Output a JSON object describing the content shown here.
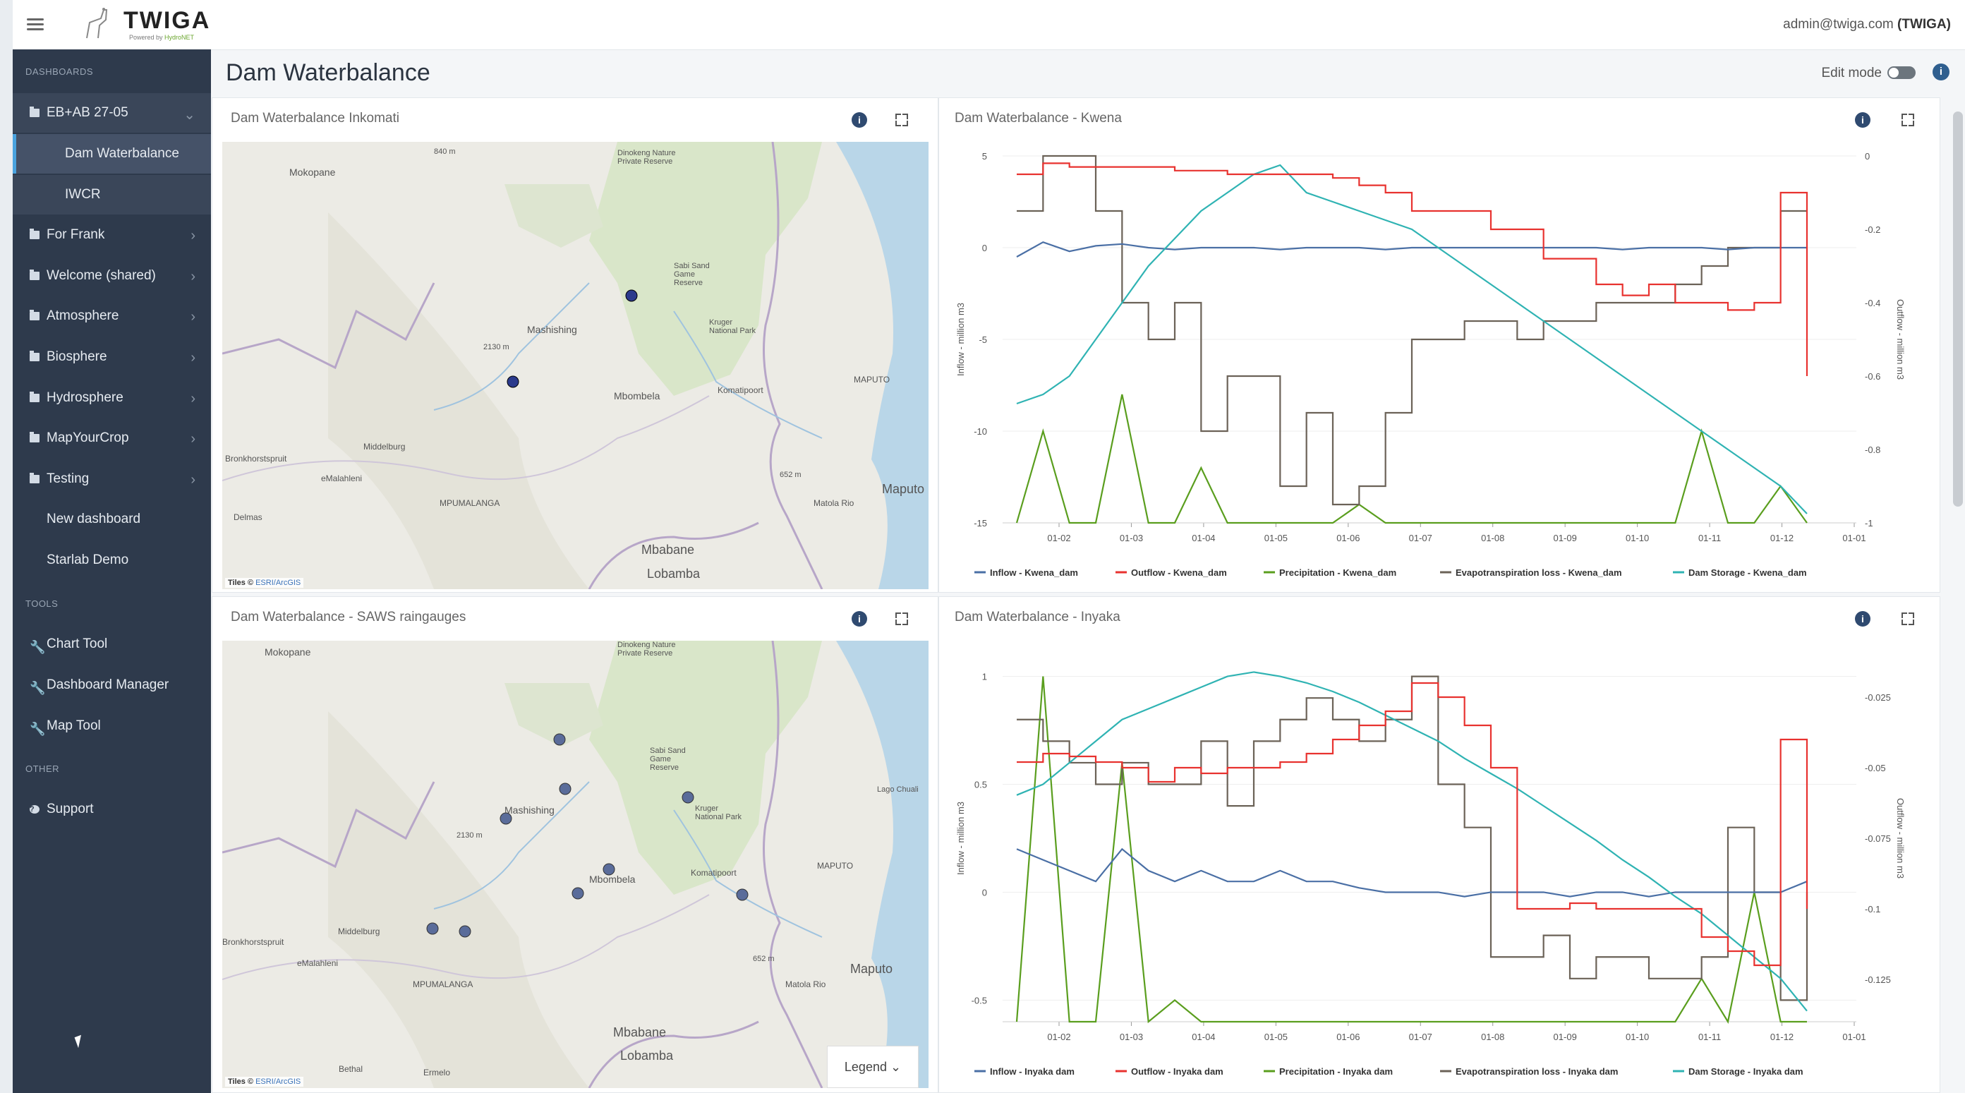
{
  "app": {
    "logo_text": "TWIGA",
    "logo_sub_prefix": "Powered by",
    "logo_sub_brand": "HydroNET",
    "user_name": "admin@twiga.com",
    "user_org": "(TWIGA)"
  },
  "sidebar": {
    "section_dashboards": "DASHBOARDS",
    "section_tools": "TOOLS",
    "section_other": "OTHER",
    "items": [
      {
        "label": "EB+AB 27-05"
      },
      {
        "label": "Dam Waterbalance"
      },
      {
        "label": "IWCR"
      },
      {
        "label": "For Frank"
      },
      {
        "label": "Welcome (shared)"
      },
      {
        "label": "Atmosphere"
      },
      {
        "label": "Biosphere"
      },
      {
        "label": "Hydrosphere"
      },
      {
        "label": "MapYourCrop"
      },
      {
        "label": "Testing"
      },
      {
        "label": "New dashboard"
      },
      {
        "label": "Starlab Demo"
      }
    ],
    "tools": [
      {
        "label": "Chart Tool"
      },
      {
        "label": "Dashboard Manager"
      },
      {
        "label": "Map Tool"
      }
    ],
    "other": [
      {
        "label": "Support"
      }
    ]
  },
  "page": {
    "title": "Dam Waterbalance",
    "edit_mode_label": "Edit mode",
    "edit_mode_on": false
  },
  "panels": {
    "map1": {
      "title": "Dam Waterbalance Inkomati",
      "labels": [
        "Mokopane",
        "Dinokeng Nature Private Reserve",
        "Sabi Sand Game Reserve",
        "Mashishing",
        "Kruger National Park",
        "2130 m",
        "Mbombela",
        "Komatipoort",
        "MAPUTO",
        "Middelburg",
        "Bronkhorstspruit",
        "eMalahleni",
        "MPUMALANGA",
        "Matola Rio",
        "Maputo",
        "652 m",
        "Delmas",
        "Mbabane",
        "Lobamba",
        "840 m"
      ],
      "attribution_prefix": "Tiles ©",
      "attribution_link": "ESRI/ArcGIS"
    },
    "map2": {
      "title": "Dam Waterbalance - SAWS raingauges",
      "labels": [
        "Mokopane",
        "Dinokeng Nature Private Reserve",
        "Sabi Sand Game Reserve",
        "Mashishing",
        "Kruger National Park",
        "2130 m",
        "Mbombela",
        "Komatipoort",
        "MAPUTO",
        "Middelburg",
        "Bronkhorstspruit",
        "eMalahleni",
        "MPUMALANGA",
        "Matola Rio",
        "Maputo",
        "652 m",
        "Mbabane",
        "Lobamba",
        "Bethal",
        "Ermelo",
        "Lago Chuali"
      ],
      "attribution_prefix": "Tiles ©",
      "attribution_link": "ESRI/ArcGIS",
      "legend_label": "Legend"
    },
    "chart1": {
      "title": "Dam Waterbalance - Kwena"
    },
    "chart2": {
      "title": "Dam Waterbalance - Inyaka"
    }
  },
  "colors": {
    "inflow": "#4a6fa5",
    "outflow": "#e8322f",
    "precip": "#5a9e1e",
    "evap": "#6b6257",
    "storage": "#2fb3b3",
    "dots": "#2b3a8c"
  },
  "chart_data": [
    {
      "type": "line",
      "title": "Dam Waterbalance - Kwena",
      "x_ticks": [
        "01-02",
        "01-03",
        "01-04",
        "01-05",
        "01-06",
        "01-07",
        "01-08",
        "01-09",
        "01-10",
        "01-11",
        "01-12",
        "01-01"
      ],
      "ylabel": "Inflow - million m3",
      "y2label": "Outflow - million m3",
      "y_ticks": [
        "5",
        "0",
        "-5",
        "-10",
        "-15"
      ],
      "y2_ticks": [
        "0",
        "-0.2",
        "-0.4",
        "-0.6",
        "-0.8",
        "-1"
      ],
      "ylim": [
        -15,
        5
      ],
      "y2lim": [
        -1,
        0
      ],
      "series": [
        {
          "name": "Inflow - Kwena_dam",
          "key": "inflow",
          "axis": "left",
          "values": [
            -0.5,
            0.3,
            -0.2,
            0.1,
            0.2,
            0,
            -0.1,
            0,
            0,
            0,
            -0.1,
            0,
            0,
            0,
            -0.1,
            0,
            0,
            0,
            0,
            0,
            0,
            0,
            0,
            -0.1,
            0,
            0,
            0,
            -0.1,
            0,
            0,
            0
          ]
        },
        {
          "name": "Outflow - Kwena_dam",
          "key": "outflow",
          "axis": "right",
          "values": [
            -0.05,
            -0.02,
            -0.03,
            -0.03,
            -0.03,
            -0.03,
            -0.04,
            -0.04,
            -0.05,
            -0.05,
            -0.05,
            -0.05,
            -0.06,
            -0.08,
            -0.1,
            -0.15,
            -0.15,
            -0.15,
            -0.2,
            -0.2,
            -0.28,
            -0.28,
            -0.35,
            -0.38,
            -0.35,
            -0.4,
            -0.4,
            -0.42,
            -0.4,
            -0.1,
            -0.6
          ]
        },
        {
          "name": "Precipitation - Kwena_dam",
          "key": "precip",
          "axis": "left",
          "values": [
            -15,
            -10,
            -15,
            -15,
            -8,
            -15,
            -15,
            -12,
            -15,
            -15,
            -15,
            -15,
            -15,
            -14,
            -15,
            -15,
            -15,
            -15,
            -15,
            -15,
            -15,
            -15,
            -15,
            -15,
            -15,
            -15,
            -10,
            -15,
            -15,
            -13,
            -15
          ]
        },
        {
          "name": "Evapotranspiration loss - Kwena_dam",
          "key": "evap",
          "axis": "left",
          "values": [
            2,
            5,
            5,
            2,
            -3,
            -5,
            -3,
            -10,
            -7,
            -7,
            -13,
            -9,
            -14,
            -13,
            -9,
            -5,
            -5,
            -4,
            -4,
            -5,
            -4,
            -4,
            -3,
            -3,
            -3,
            -2,
            -1,
            0,
            0,
            2,
            2
          ]
        },
        {
          "name": "Dam Storage - Kwena_dam",
          "key": "storage",
          "axis": "left",
          "values": [
            -8.5,
            -8,
            -7,
            -5,
            -3,
            -1,
            0.5,
            2,
            3,
            4,
            4.5,
            3,
            2.5,
            2,
            1.5,
            1,
            0,
            -1,
            -2,
            -3,
            -4,
            -5,
            -6,
            -7,
            -8,
            -9,
            -10,
            -11,
            -12,
            -13,
            -14.5
          ]
        }
      ]
    },
    {
      "type": "line",
      "title": "Dam Waterbalance - Inyaka",
      "x_ticks": [
        "01-02",
        "01-03",
        "01-04",
        "01-05",
        "01-06",
        "01-07",
        "01-08",
        "01-09",
        "01-10",
        "01-11",
        "01-12",
        "01-01"
      ],
      "ylabel": "Inflow - million m3",
      "y2label": "Outflow - million m3",
      "y_ticks": [
        "1",
        "0.5",
        "0",
        "-0.5"
      ],
      "y2_ticks": [
        "-0.025",
        "-0.05",
        "-0.075",
        "-0.1",
        "-0.125"
      ],
      "ylim": [
        -0.6,
        1.1
      ],
      "y2lim": [
        -0.14,
        -0.01
      ],
      "series": [
        {
          "name": "Inflow - Inyaka dam",
          "key": "inflow",
          "axis": "left",
          "values": [
            0.2,
            0.15,
            0.1,
            0.05,
            0.2,
            0.1,
            0.05,
            0.1,
            0.05,
            0.05,
            0.1,
            0.05,
            0.05,
            0.02,
            0,
            0,
            0,
            -0.02,
            0,
            0,
            0,
            -0.02,
            0,
            0,
            -0.02,
            0,
            0,
            0,
            0,
            0,
            0.05
          ]
        },
        {
          "name": "Outflow - Inyaka dam",
          "key": "outflow",
          "axis": "right",
          "values": [
            -0.048,
            -0.045,
            -0.046,
            -0.048,
            -0.05,
            -0.055,
            -0.05,
            -0.052,
            -0.05,
            -0.05,
            -0.048,
            -0.045,
            -0.04,
            -0.035,
            -0.03,
            -0.02,
            -0.025,
            -0.035,
            -0.05,
            -0.1,
            -0.1,
            -0.098,
            -0.1,
            -0.1,
            -0.1,
            -0.1,
            -0.11,
            -0.115,
            -0.12,
            -0.04,
            -0.1
          ]
        },
        {
          "name": "Precipitation - Inyaka dam",
          "key": "precip",
          "axis": "left",
          "values": [
            -0.6,
            1.0,
            -0.6,
            -0.6,
            0.6,
            -0.6,
            -0.5,
            -0.6,
            -0.6,
            -0.6,
            -0.6,
            -0.6,
            -0.6,
            -0.6,
            -0.6,
            -0.6,
            -0.6,
            -0.6,
            -0.6,
            -0.6,
            -0.6,
            -0.6,
            -0.6,
            -0.6,
            -0.6,
            -0.6,
            -0.4,
            -0.6,
            0,
            -0.6,
            -0.6
          ]
        },
        {
          "name": "Evapotranspiration loss - Inyaka dam",
          "key": "evap",
          "axis": "left",
          "values": [
            0.8,
            0.7,
            0.6,
            0.5,
            0.6,
            0.5,
            0.5,
            0.7,
            0.4,
            0.7,
            0.8,
            0.9,
            0.8,
            0.7,
            0.8,
            1.0,
            0.5,
            0.3,
            -0.3,
            -0.3,
            -0.2,
            -0.4,
            -0.3,
            -0.3,
            -0.4,
            -0.4,
            -0.3,
            0.3,
            0,
            -0.5,
            0
          ]
        },
        {
          "name": "Dam Storage - Inyaka dam",
          "key": "storage",
          "axis": "left",
          "values": [
            0.45,
            0.5,
            0.6,
            0.7,
            0.8,
            0.85,
            0.9,
            0.95,
            1.0,
            1.02,
            1.0,
            0.97,
            0.93,
            0.88,
            0.82,
            0.76,
            0.7,
            0.62,
            0.55,
            0.48,
            0.4,
            0.32,
            0.24,
            0.15,
            0.07,
            -0.02,
            -0.1,
            -0.2,
            -0.3,
            -0.4,
            -0.55
          ]
        }
      ]
    }
  ]
}
